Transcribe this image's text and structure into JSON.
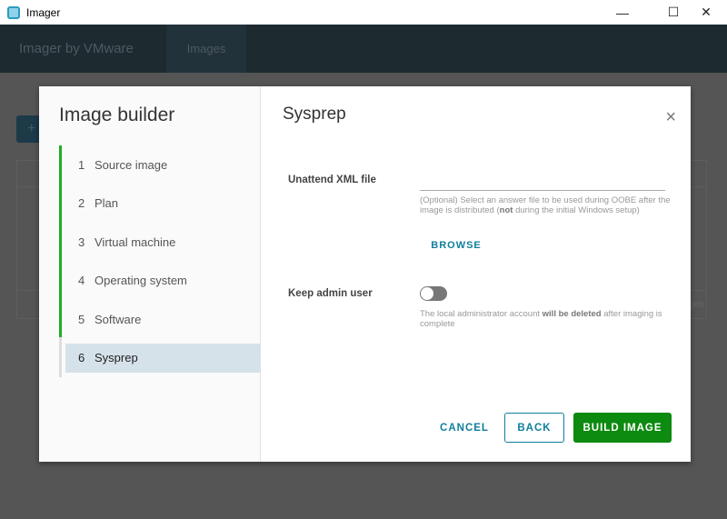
{
  "window": {
    "title": "Imager",
    "minimize": "—",
    "maximize": "☐",
    "close": "✕"
  },
  "header": {
    "brand": "Imager by VMware",
    "nav_images": "Images"
  },
  "background": {
    "add_button": "+",
    "partial_text": "ges"
  },
  "modal": {
    "sidebar_title": "Image builder",
    "progress_completed_steps": 5,
    "steps": [
      {
        "num": "1",
        "label": "Source image"
      },
      {
        "num": "2",
        "label": "Plan"
      },
      {
        "num": "3",
        "label": "Virtual machine"
      },
      {
        "num": "4",
        "label": "Operating system"
      },
      {
        "num": "5",
        "label": "Software"
      },
      {
        "num": "6",
        "label": "Sysprep"
      }
    ],
    "title": "Sysprep",
    "close": "×",
    "unattend": {
      "label": "Unattend XML file",
      "value": "",
      "help_pre": "(Optional) Select an answer file to be used during OOBE after the image is distributed (",
      "help_bold": "not",
      "help_post": " during the initial Windows setup)",
      "browse": "BROWSE"
    },
    "keep_admin": {
      "label": "Keep admin user",
      "enabled": false,
      "help_pre": "The local administrator account ",
      "help_bold": "will be deleted",
      "help_post": " after imaging is complete"
    },
    "buttons": {
      "cancel": "CANCEL",
      "back": "BACK",
      "build": "BUILD IMAGE"
    }
  }
}
